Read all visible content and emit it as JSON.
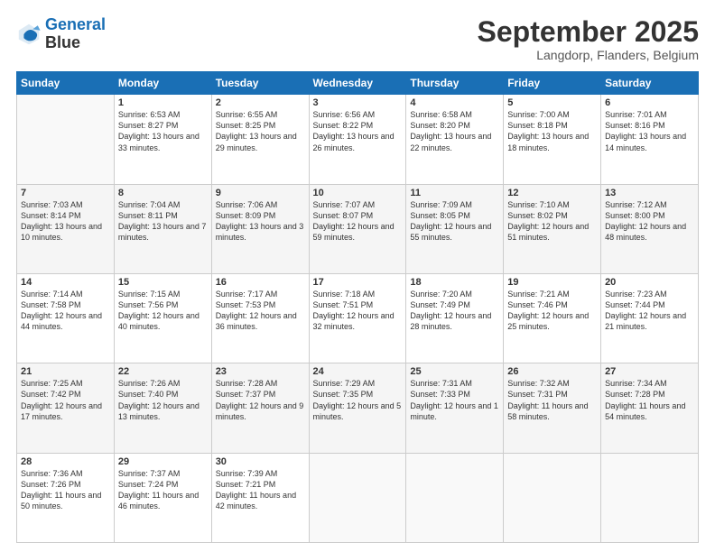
{
  "logo": {
    "line1": "General",
    "line2": "Blue"
  },
  "header": {
    "month": "September 2025",
    "location": "Langdorp, Flanders, Belgium"
  },
  "weekdays": [
    "Sunday",
    "Monday",
    "Tuesday",
    "Wednesday",
    "Thursday",
    "Friday",
    "Saturday"
  ],
  "weeks": [
    [
      {
        "day": "",
        "sunrise": "",
        "sunset": "",
        "daylight": ""
      },
      {
        "day": "1",
        "sunrise": "Sunrise: 6:53 AM",
        "sunset": "Sunset: 8:27 PM",
        "daylight": "Daylight: 13 hours and 33 minutes."
      },
      {
        "day": "2",
        "sunrise": "Sunrise: 6:55 AM",
        "sunset": "Sunset: 8:25 PM",
        "daylight": "Daylight: 13 hours and 29 minutes."
      },
      {
        "day": "3",
        "sunrise": "Sunrise: 6:56 AM",
        "sunset": "Sunset: 8:22 PM",
        "daylight": "Daylight: 13 hours and 26 minutes."
      },
      {
        "day": "4",
        "sunrise": "Sunrise: 6:58 AM",
        "sunset": "Sunset: 8:20 PM",
        "daylight": "Daylight: 13 hours and 22 minutes."
      },
      {
        "day": "5",
        "sunrise": "Sunrise: 7:00 AM",
        "sunset": "Sunset: 8:18 PM",
        "daylight": "Daylight: 13 hours and 18 minutes."
      },
      {
        "day": "6",
        "sunrise": "Sunrise: 7:01 AM",
        "sunset": "Sunset: 8:16 PM",
        "daylight": "Daylight: 13 hours and 14 minutes."
      }
    ],
    [
      {
        "day": "7",
        "sunrise": "Sunrise: 7:03 AM",
        "sunset": "Sunset: 8:14 PM",
        "daylight": "Daylight: 13 hours and 10 minutes."
      },
      {
        "day": "8",
        "sunrise": "Sunrise: 7:04 AM",
        "sunset": "Sunset: 8:11 PM",
        "daylight": "Daylight: 13 hours and 7 minutes."
      },
      {
        "day": "9",
        "sunrise": "Sunrise: 7:06 AM",
        "sunset": "Sunset: 8:09 PM",
        "daylight": "Daylight: 13 hours and 3 minutes."
      },
      {
        "day": "10",
        "sunrise": "Sunrise: 7:07 AM",
        "sunset": "Sunset: 8:07 PM",
        "daylight": "Daylight: 12 hours and 59 minutes."
      },
      {
        "day": "11",
        "sunrise": "Sunrise: 7:09 AM",
        "sunset": "Sunset: 8:05 PM",
        "daylight": "Daylight: 12 hours and 55 minutes."
      },
      {
        "day": "12",
        "sunrise": "Sunrise: 7:10 AM",
        "sunset": "Sunset: 8:02 PM",
        "daylight": "Daylight: 12 hours and 51 minutes."
      },
      {
        "day": "13",
        "sunrise": "Sunrise: 7:12 AM",
        "sunset": "Sunset: 8:00 PM",
        "daylight": "Daylight: 12 hours and 48 minutes."
      }
    ],
    [
      {
        "day": "14",
        "sunrise": "Sunrise: 7:14 AM",
        "sunset": "Sunset: 7:58 PM",
        "daylight": "Daylight: 12 hours and 44 minutes."
      },
      {
        "day": "15",
        "sunrise": "Sunrise: 7:15 AM",
        "sunset": "Sunset: 7:56 PM",
        "daylight": "Daylight: 12 hours and 40 minutes."
      },
      {
        "day": "16",
        "sunrise": "Sunrise: 7:17 AM",
        "sunset": "Sunset: 7:53 PM",
        "daylight": "Daylight: 12 hours and 36 minutes."
      },
      {
        "day": "17",
        "sunrise": "Sunrise: 7:18 AM",
        "sunset": "Sunset: 7:51 PM",
        "daylight": "Daylight: 12 hours and 32 minutes."
      },
      {
        "day": "18",
        "sunrise": "Sunrise: 7:20 AM",
        "sunset": "Sunset: 7:49 PM",
        "daylight": "Daylight: 12 hours and 28 minutes."
      },
      {
        "day": "19",
        "sunrise": "Sunrise: 7:21 AM",
        "sunset": "Sunset: 7:46 PM",
        "daylight": "Daylight: 12 hours and 25 minutes."
      },
      {
        "day": "20",
        "sunrise": "Sunrise: 7:23 AM",
        "sunset": "Sunset: 7:44 PM",
        "daylight": "Daylight: 12 hours and 21 minutes."
      }
    ],
    [
      {
        "day": "21",
        "sunrise": "Sunrise: 7:25 AM",
        "sunset": "Sunset: 7:42 PM",
        "daylight": "Daylight: 12 hours and 17 minutes."
      },
      {
        "day": "22",
        "sunrise": "Sunrise: 7:26 AM",
        "sunset": "Sunset: 7:40 PM",
        "daylight": "Daylight: 12 hours and 13 minutes."
      },
      {
        "day": "23",
        "sunrise": "Sunrise: 7:28 AM",
        "sunset": "Sunset: 7:37 PM",
        "daylight": "Daylight: 12 hours and 9 minutes."
      },
      {
        "day": "24",
        "sunrise": "Sunrise: 7:29 AM",
        "sunset": "Sunset: 7:35 PM",
        "daylight": "Daylight: 12 hours and 5 minutes."
      },
      {
        "day": "25",
        "sunrise": "Sunrise: 7:31 AM",
        "sunset": "Sunset: 7:33 PM",
        "daylight": "Daylight: 12 hours and 1 minute."
      },
      {
        "day": "26",
        "sunrise": "Sunrise: 7:32 AM",
        "sunset": "Sunset: 7:31 PM",
        "daylight": "Daylight: 11 hours and 58 minutes."
      },
      {
        "day": "27",
        "sunrise": "Sunrise: 7:34 AM",
        "sunset": "Sunset: 7:28 PM",
        "daylight": "Daylight: 11 hours and 54 minutes."
      }
    ],
    [
      {
        "day": "28",
        "sunrise": "Sunrise: 7:36 AM",
        "sunset": "Sunset: 7:26 PM",
        "daylight": "Daylight: 11 hours and 50 minutes."
      },
      {
        "day": "29",
        "sunrise": "Sunrise: 7:37 AM",
        "sunset": "Sunset: 7:24 PM",
        "daylight": "Daylight: 11 hours and 46 minutes."
      },
      {
        "day": "30",
        "sunrise": "Sunrise: 7:39 AM",
        "sunset": "Sunset: 7:21 PM",
        "daylight": "Daylight: 11 hours and 42 minutes."
      },
      {
        "day": "",
        "sunrise": "",
        "sunset": "",
        "daylight": ""
      },
      {
        "day": "",
        "sunrise": "",
        "sunset": "",
        "daylight": ""
      },
      {
        "day": "",
        "sunrise": "",
        "sunset": "",
        "daylight": ""
      },
      {
        "day": "",
        "sunrise": "",
        "sunset": "",
        "daylight": ""
      }
    ]
  ]
}
